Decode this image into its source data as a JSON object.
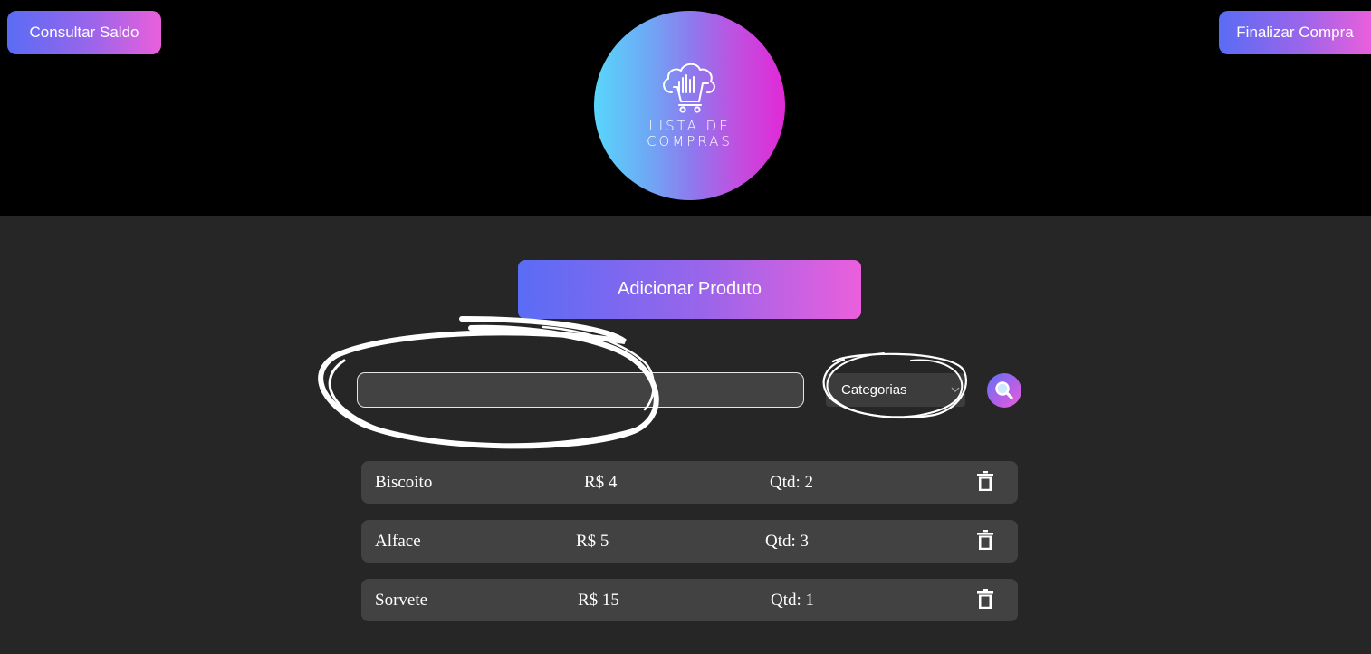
{
  "header": {
    "saldo_label": "Consultar Saldo",
    "finalizar_label": "Finalizar Compra",
    "logo": {
      "icon": "cloud-cart-icon",
      "line1": "LISTA DE",
      "line2": "COMPRAS"
    }
  },
  "main": {
    "add_product_label": "Adicionar Produto",
    "search": {
      "value": "",
      "placeholder": ""
    },
    "category_select": {
      "selected": "Categorias"
    },
    "search_button_icon": "magnifier-icon",
    "products": [
      {
        "name": "Biscoito",
        "price": "R$ 4",
        "qty": "Qtd: 2",
        "delete_icon": "trash-icon"
      },
      {
        "name": "Alface",
        "price": "R$ 5",
        "qty": "Qtd: 3",
        "delete_icon": "trash-icon"
      },
      {
        "name": "Sorvete",
        "price": "R$ 15",
        "qty": "Qtd: 1",
        "delete_icon": "trash-icon"
      }
    ]
  },
  "colors": {
    "header_bg": "#000000",
    "page_bg": "#262626",
    "row_bg": "#424242",
    "gradient_start": "#5a6cf5",
    "gradient_end": "#ea5fdc",
    "logo_gradient_start": "#58d6fb",
    "logo_gradient_end": "#e129d6"
  }
}
